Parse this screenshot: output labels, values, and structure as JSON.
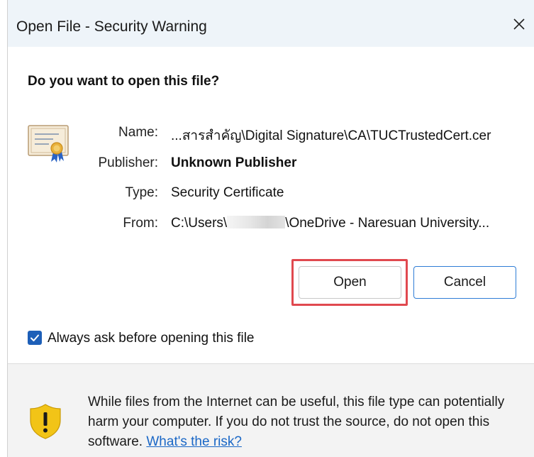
{
  "window": {
    "title": "Open File - Security Warning",
    "question": "Do you want to open this file?"
  },
  "fields": {
    "name_label": "Name:",
    "name_value": "...สารสำคัญ\\Digital Signature\\CA\\TUCTrustedCert.cer",
    "publisher_label": "Publisher:",
    "publisher_value": "Unknown Publisher",
    "type_label": "Type:",
    "type_value": "Security Certificate",
    "from_label": "From:",
    "from_value_prefix": "C:\\Users\\",
    "from_value_suffix": "\\OneDrive - Naresuan University..."
  },
  "buttons": {
    "open_label": "Open",
    "cancel_label": "Cancel"
  },
  "checkbox": {
    "label": "Always ask before opening this file",
    "checked": true
  },
  "footer": {
    "warning_text": "While files from the Internet can be useful, this file type can potentially harm your computer. If you do not trust the source, do not open this software.",
    "risk_link": "What's the risk?"
  },
  "icons": {
    "certificate": "certificate-icon",
    "shield": "warning-shield-icon",
    "close": "close-icon",
    "check": "check-icon"
  },
  "colors": {
    "accent": "#1d5fb8",
    "highlight": "#e0494f",
    "link": "#1a67c6",
    "shield": "#f2c417"
  }
}
